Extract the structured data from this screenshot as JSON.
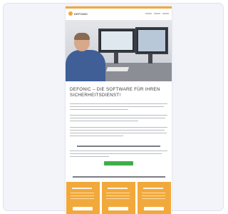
{
  "site": {
    "logo_text": "DEFONIC",
    "headline": "DEFONIC – DIE SOFTWARE FÜR IHREN SICHERHEITSDIENST!",
    "cta_label": ""
  },
  "colors": {
    "accent": "#f0a73a",
    "cta": "#3fae49"
  },
  "icons": {
    "logo": "defonic-logo-mark"
  }
}
